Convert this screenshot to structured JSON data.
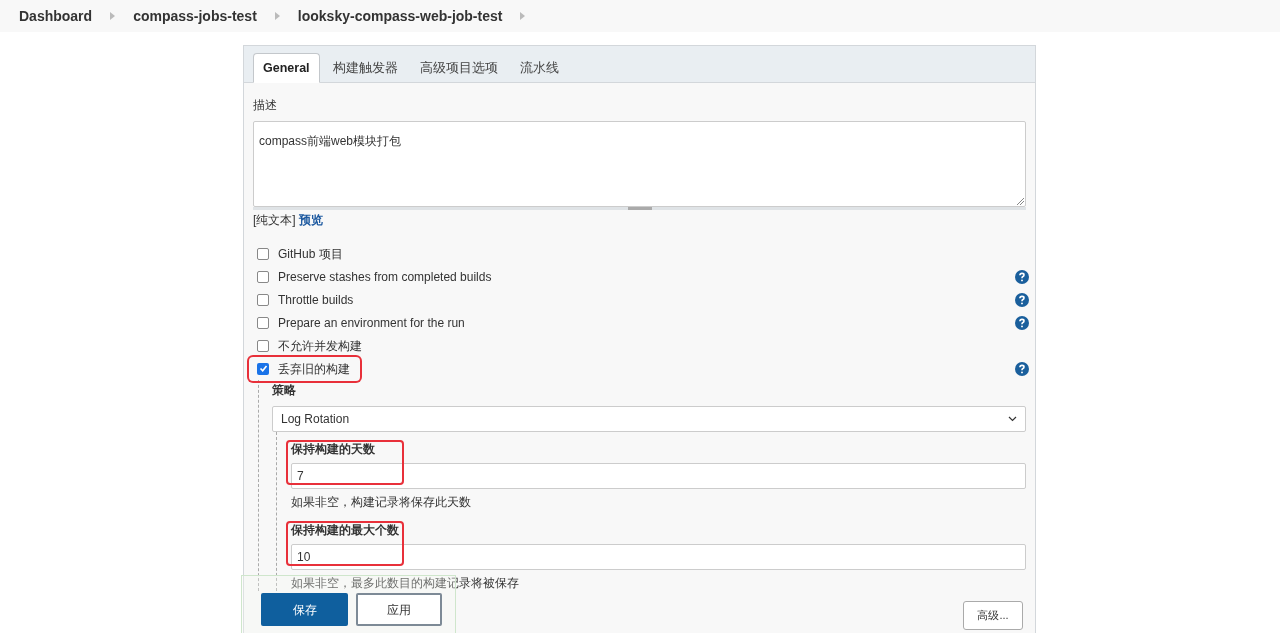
{
  "breadcrumbs": [
    "Dashboard",
    "compass-jobs-test",
    "looksky-compass-web-job-test"
  ],
  "tabs": [
    {
      "label": "General",
      "selected": true
    },
    {
      "label": "构建触发器",
      "selected": false
    },
    {
      "label": "高级项目选项",
      "selected": false
    },
    {
      "label": "流水线",
      "selected": false
    }
  ],
  "description": {
    "label": "描述",
    "value": "compass前端web模块打包",
    "format": "[纯文本]",
    "preview_link": "预览"
  },
  "options": [
    {
      "label": "GitHub 项目",
      "checked": false,
      "help": false,
      "highlighted": false
    },
    {
      "label": "Preserve stashes from completed builds",
      "checked": false,
      "help": true,
      "highlighted": false
    },
    {
      "label": "Throttle builds",
      "checked": false,
      "help": true,
      "highlighted": false
    },
    {
      "label": "Prepare an environment for the run",
      "checked": false,
      "help": true,
      "highlighted": false
    },
    {
      "label": "不允许并发构建",
      "checked": false,
      "help": false,
      "highlighted": false
    },
    {
      "label": "丢弃旧的构建",
      "checked": true,
      "help": true,
      "highlighted": true
    }
  ],
  "strategy": {
    "label": "策略",
    "value": "Log Rotation"
  },
  "fields": [
    {
      "label": "保持构建的天数",
      "value": "7",
      "hint": "如果非空，构建记录将保存此天数",
      "highlighted": true
    },
    {
      "label": "保持构建的最大个数",
      "value": "10",
      "hint": "如果非空，最多此数目的构建记录将被保存",
      "highlighted": true
    }
  ],
  "buttons": {
    "save": "保存",
    "apply": "应用",
    "advanced": "高级..."
  }
}
